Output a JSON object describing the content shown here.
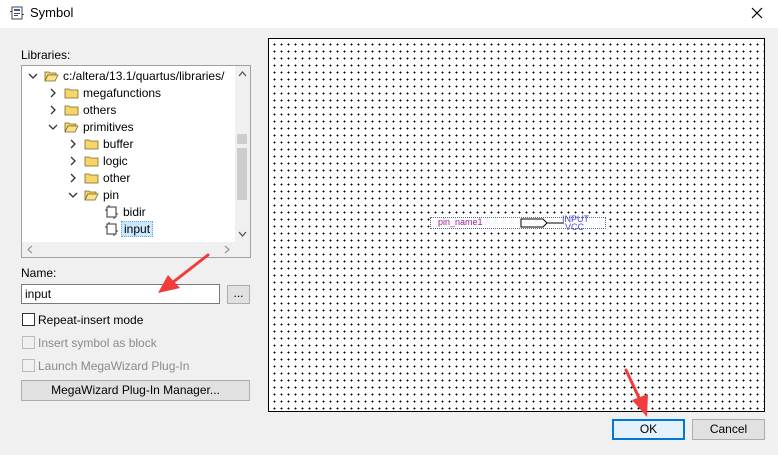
{
  "window": {
    "title": "Symbol"
  },
  "libraries": {
    "label": "Libraries:",
    "tree": [
      {
        "label": "c:/altera/13.1/quartus/libraries/",
        "level": 0,
        "expanded": true,
        "icon": "folder-open-icon"
      },
      {
        "label": "megafunctions",
        "level": 1,
        "expanded": false,
        "icon": "folder-icon"
      },
      {
        "label": "others",
        "level": 1,
        "expanded": false,
        "icon": "folder-icon"
      },
      {
        "label": "primitives",
        "level": 1,
        "expanded": true,
        "icon": "folder-open-icon"
      },
      {
        "label": "buffer",
        "level": 2,
        "expanded": false,
        "icon": "folder-icon"
      },
      {
        "label": "logic",
        "level": 2,
        "expanded": false,
        "icon": "folder-icon"
      },
      {
        "label": "other",
        "level": 2,
        "expanded": false,
        "icon": "folder-icon"
      },
      {
        "label": "pin",
        "level": 2,
        "expanded": true,
        "icon": "folder-open-icon"
      },
      {
        "label": "bidir",
        "level": 3,
        "icon": "symbol-icon"
      },
      {
        "label": "input",
        "level": 3,
        "icon": "symbol-icon",
        "selected": true
      }
    ]
  },
  "name": {
    "label": "Name:",
    "value": "input",
    "browse_label": "..."
  },
  "options": {
    "repeat_insert": {
      "label": "Repeat-insert mode",
      "checked": false,
      "enabled": true
    },
    "insert_block": {
      "label": "Insert symbol as block",
      "checked": false,
      "enabled": false
    },
    "launch_megawizard": {
      "label": "Launch MegaWizard Plug-In",
      "checked": false,
      "enabled": false
    }
  },
  "megawizard_button": {
    "label": "MegaWizard Plug-In Manager..."
  },
  "preview": {
    "pin_name": "pin_name1",
    "type": "INPUT",
    "default": "VCC"
  },
  "buttons": {
    "ok": "OK",
    "cancel": "Cancel"
  },
  "colors": {
    "annotation_arrow": "#f03c3c",
    "pin_name_text": "#9c1f9c",
    "pin_type_text": "#4a4ad8",
    "ok_border": "#0078d7",
    "selection": "#cce8ff"
  }
}
